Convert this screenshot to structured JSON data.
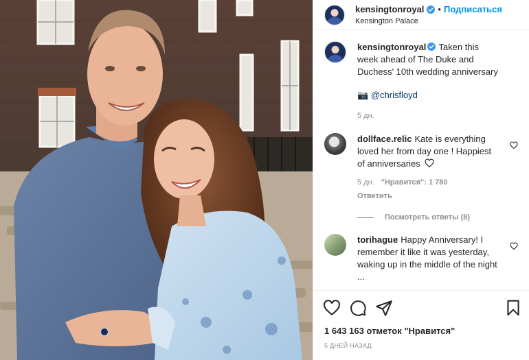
{
  "header": {
    "username": "kensingtonroyal",
    "follow_label": "Подписаться",
    "separator": "•",
    "location": "Kensington Palace"
  },
  "caption": {
    "username": "kensingtonroyal",
    "text": "Taken this week ahead of The Duke and Duchess' 10th wedding anniversary",
    "camera_emoji": "📷",
    "credit": "@chrisfloyd",
    "time": "5 дн."
  },
  "comments": [
    {
      "username": "dollface.relic",
      "text": "Kate is everything loved her from day one ! Happiest of anniversaries",
      "time": "5 дн.",
      "likes": "\"Нравится\": 1 780",
      "reply_label": "Ответить",
      "view_replies": "Посмотреть ответы (8)"
    },
    {
      "username": "torihague",
      "text": "Happy Anniversary! I remember it like it was yesterday, waking up in the middle of the night ..."
    }
  ],
  "likes_text": "1 643 163 отметок \"Нравится\"",
  "post_time": "5 ДНЕЙ НАЗАД",
  "colors": {
    "accent": "#0095f6",
    "verified": "#3897f0",
    "text": "#262626",
    "muted": "#8e8e8e"
  },
  "icons": [
    "verified-badge",
    "heart-icon",
    "comment-icon",
    "share-icon",
    "bookmark-icon",
    "camera-emoji"
  ]
}
